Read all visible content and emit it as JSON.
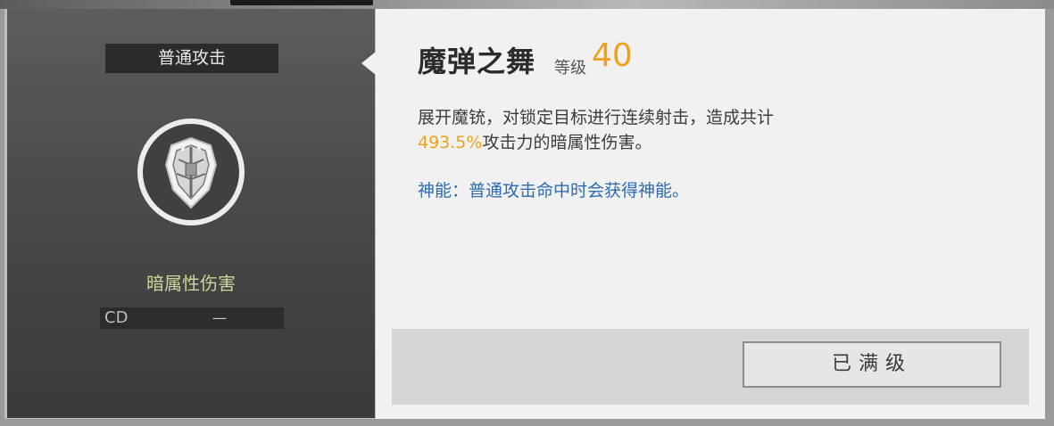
{
  "skill": {
    "category": "普通攻击",
    "name": "魔弹之舞",
    "level_label": "等级",
    "level_value": "40",
    "element": "暗属性伤害",
    "cd_label": "CD",
    "cd_value": "—",
    "icon": "shield-emblem-icon"
  },
  "description": {
    "part1": "展开魔铳，对锁定目标进行连续射击，造成共计",
    "highlight": "493.5%",
    "part2": "攻击力的暗属性伤害。"
  },
  "divine_note": "神能：普通攻击命中时会获得神能。",
  "button": {
    "label": "已满级"
  },
  "colors": {
    "accent": "#f0a11c",
    "element": "#cbd79a",
    "divine": "#2e6bb0"
  }
}
